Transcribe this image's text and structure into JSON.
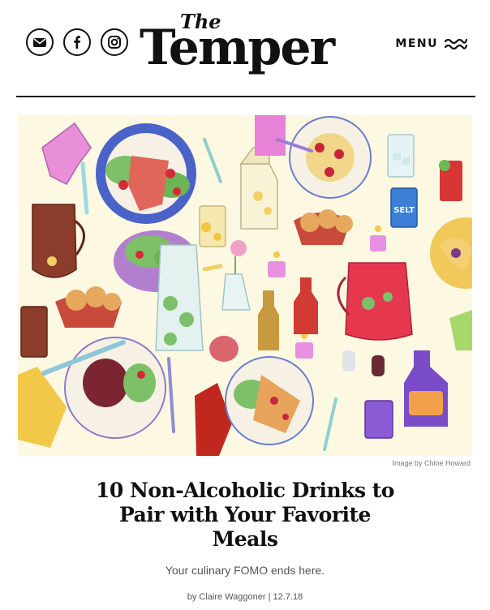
{
  "header": {
    "logo_the": "The",
    "logo_main": "Temper",
    "menu_label": "MENU",
    "social": [
      {
        "icon": "email-icon"
      },
      {
        "icon": "facebook-icon"
      },
      {
        "icon": "instagram-icon"
      }
    ]
  },
  "hero": {
    "credit": "Image by Chloe Howard",
    "can_label": "SELT"
  },
  "article": {
    "title_line1": "10 Non-Alcoholic Drinks to",
    "title_line2": "Pair with Your Favorite",
    "title_line3": "Meals",
    "dek": "Your culinary FOMO ends here.",
    "byline": "by Claire Waggoner | 12.7.18"
  },
  "colors": {
    "text": "#111111",
    "hero_background": "#fdf8e2",
    "muted": "#7a7a7a"
  }
}
